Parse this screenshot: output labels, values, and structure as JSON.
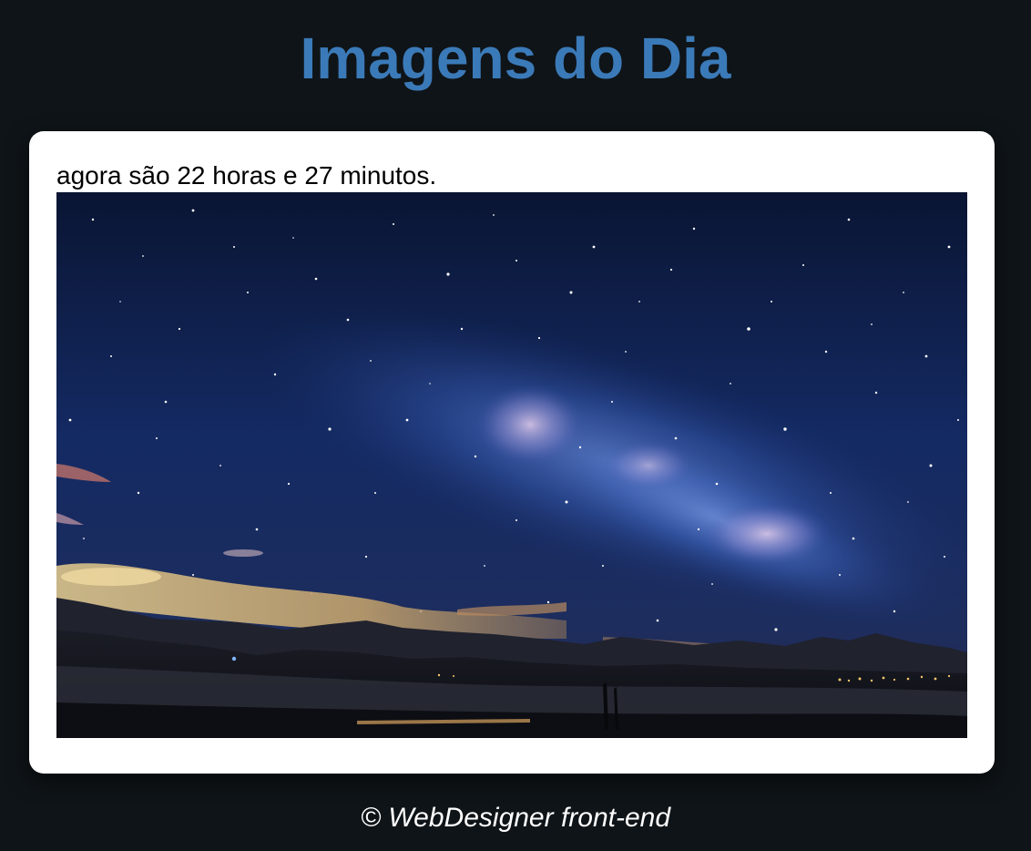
{
  "header": {
    "title": "Imagens do Dia"
  },
  "card": {
    "time_text": "agora são 22 horas e 27 minutos."
  },
  "footer": {
    "text": "© WebDesigner front-end"
  },
  "colors": {
    "background": "#0f1418",
    "title": "#3b7ab8",
    "card": "#ffffff",
    "footer_text": "#ffffff"
  }
}
